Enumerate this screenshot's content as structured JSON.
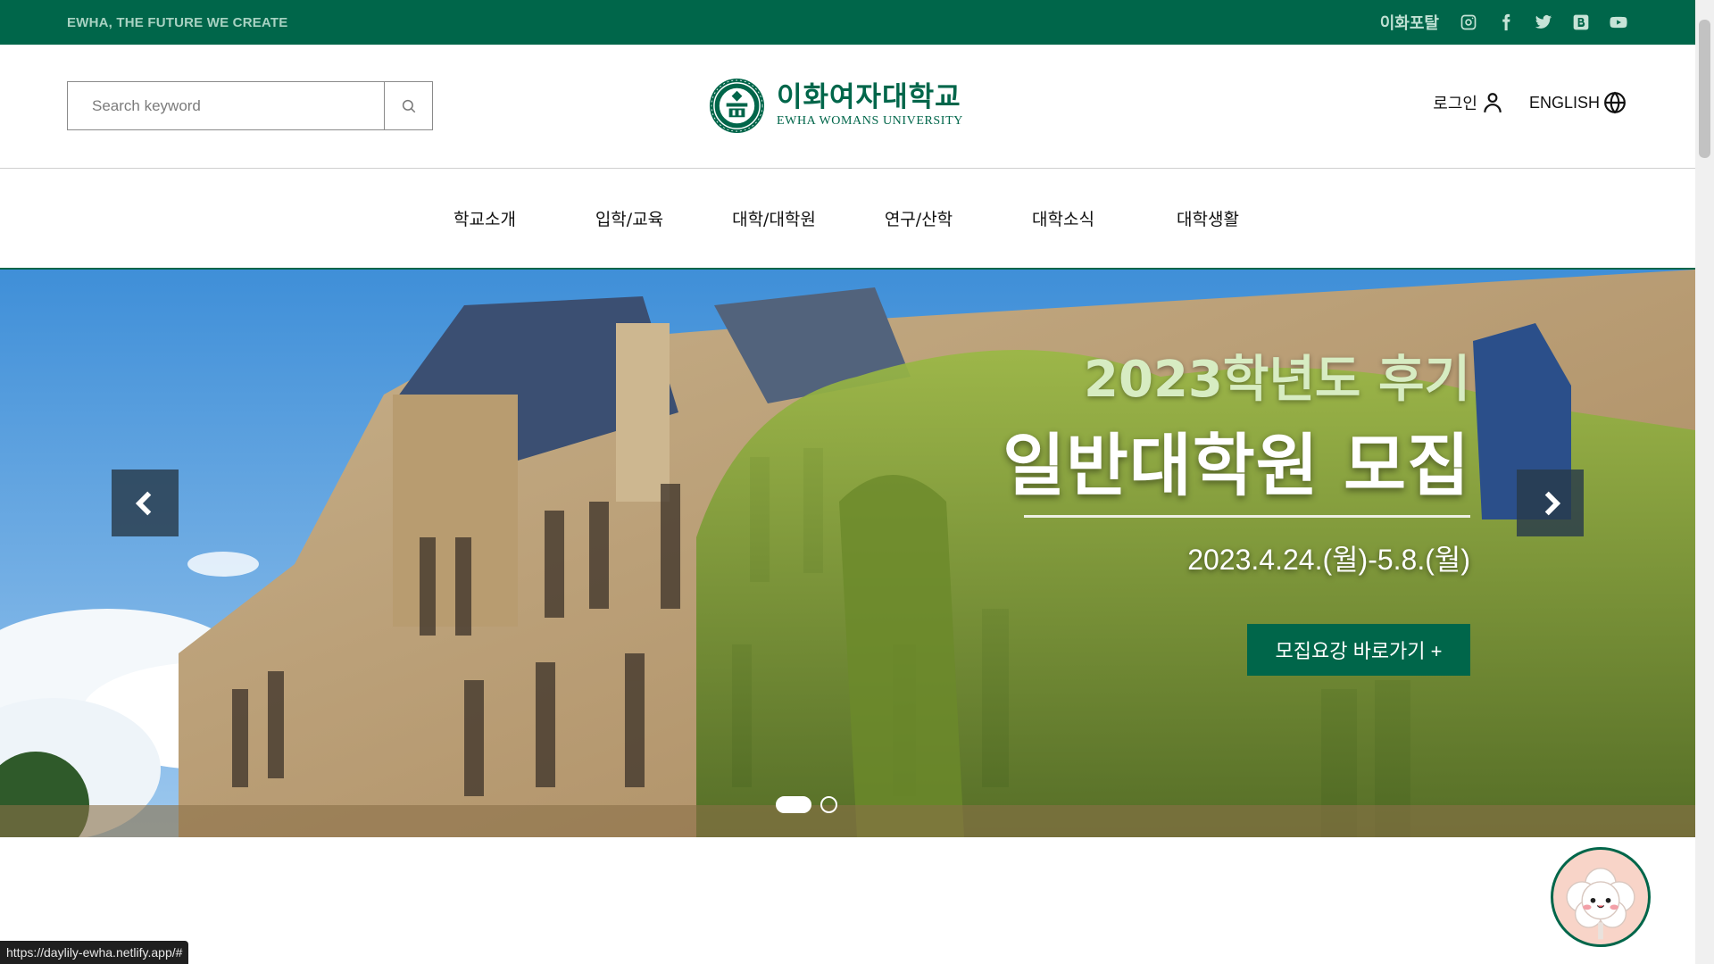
{
  "top_bar": {
    "slogan": "EWHA, THE FUTURE WE CREATE",
    "portal_label": "이화포탈",
    "sns": [
      "instagram-icon",
      "facebook-icon",
      "twitter-icon",
      "blog-icon",
      "youtube-icon"
    ]
  },
  "header": {
    "search_placeholder": "Search keyword",
    "logo_kr": "이화여자대학교",
    "logo_en": "EWHA WOMANS UNIVERSITY",
    "login_label": "로그인",
    "english_label": "ENGLISH"
  },
  "nav": {
    "items": [
      "학교소개",
      "입학/교육",
      "대학/대학원",
      "연구/산학",
      "대학소식",
      "대학생활"
    ]
  },
  "hero": {
    "title_line1": "2023학년도 후기",
    "title_line2": "일반대학원 모집",
    "date": "2023.4.24.(월)-5.8.(월)",
    "cta_label": "모집요강 바로가기 +",
    "slide_count": 2,
    "active_slide": 1
  },
  "status_bar": {
    "url": "https://daylily-ewha.netlify.app/#"
  },
  "colors": {
    "brand_green": "#00664a",
    "slogan_text": "#a8d2c2"
  }
}
